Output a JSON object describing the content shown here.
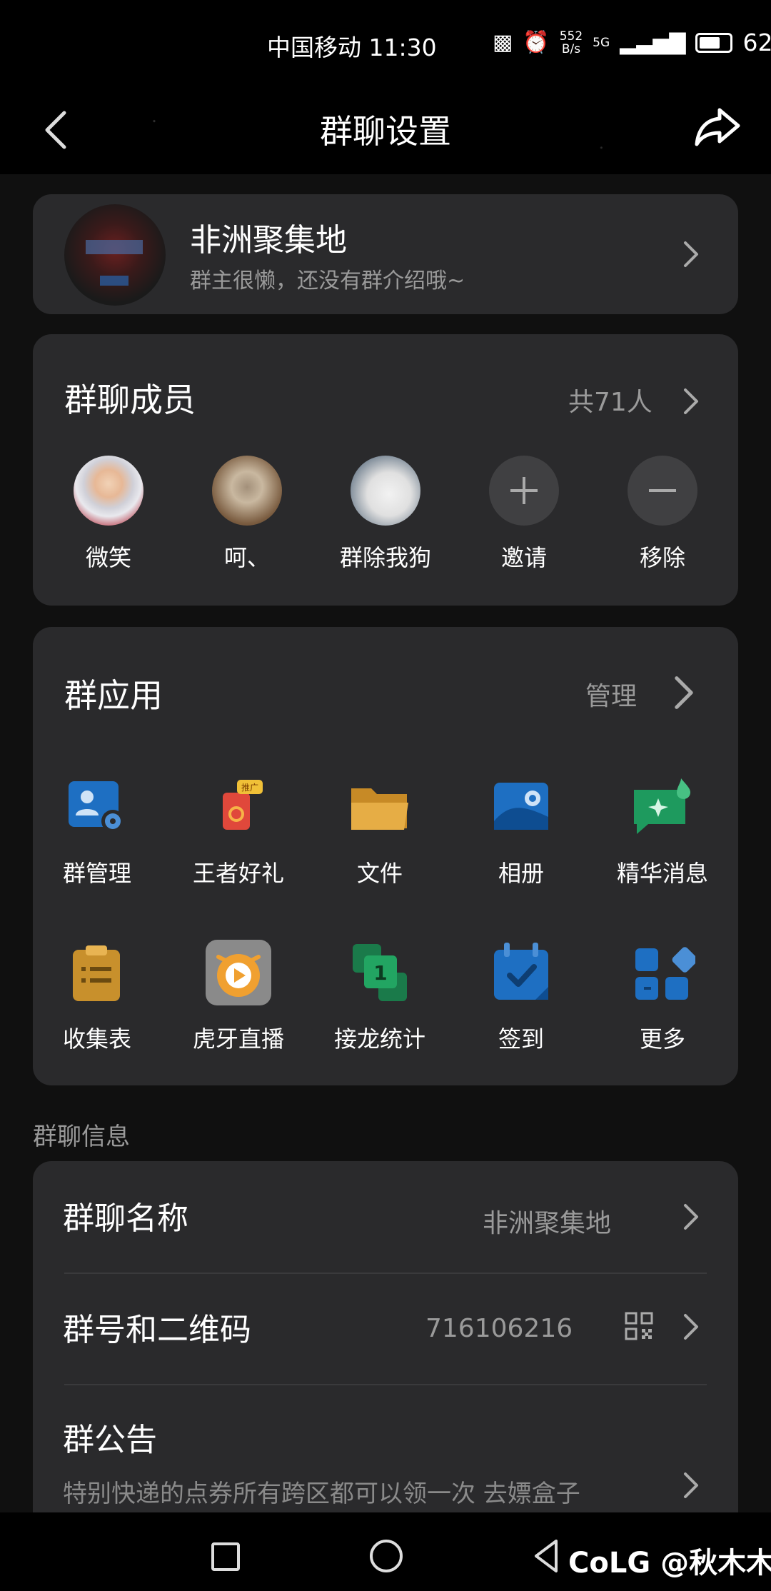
{
  "status_bar": {
    "carrier_time": "中国移动 11:30",
    "net_speed_value": "552",
    "net_speed_unit": "B/s",
    "network": "5G",
    "battery": "62%"
  },
  "nav": {
    "title": "群聊设置"
  },
  "group": {
    "name": "非洲聚集地",
    "description": "群主很懒，还没有群介绍哦~"
  },
  "members": {
    "title": "群聊成员",
    "count": "共71人",
    "list": [
      {
        "name": "微笑"
      },
      {
        "name": "呵、"
      },
      {
        "name": "群除我狗"
      }
    ],
    "invite_label": "邀请",
    "remove_label": "移除"
  },
  "apps": {
    "title": "群应用",
    "manage_label": "管理",
    "badge": "推广",
    "items": [
      {
        "label": "群管理",
        "icon": "group-manage-icon",
        "color": "#1e6fc2"
      },
      {
        "label": "王者好礼",
        "icon": "gift-icon",
        "color": "#e0483b"
      },
      {
        "label": "文件",
        "icon": "folder-icon",
        "color": "#e2a93c"
      },
      {
        "label": "相册",
        "icon": "album-icon",
        "color": "#1e6fc2"
      },
      {
        "label": "精华消息",
        "icon": "essence-message-icon",
        "color": "#21a065"
      },
      {
        "label": "收集表",
        "icon": "clipboard-icon",
        "color": "#d29a34"
      },
      {
        "label": "虎牙直播",
        "icon": "huya-live-icon",
        "color": "#f0a030"
      },
      {
        "label": "接龙统计",
        "icon": "relay-stats-icon",
        "color": "#21a065"
      },
      {
        "label": "签到",
        "icon": "checkin-calendar-icon",
        "color": "#1e6fc2"
      },
      {
        "label": "更多",
        "icon": "more-apps-icon",
        "color": "#1e6fc2"
      }
    ],
    "relay_badge_number": "1"
  },
  "info": {
    "section_label": "群聊信息",
    "name_title": "群聊名称",
    "name_value": "非洲聚集地",
    "id_title": "群号和二维码",
    "id_value": "716106216",
    "notice_title": "群公告",
    "notice_text": "特别快递的点券所有跨区都可以领一次 去嫖盒子"
  },
  "watermark": "CoLG @秋木木"
}
